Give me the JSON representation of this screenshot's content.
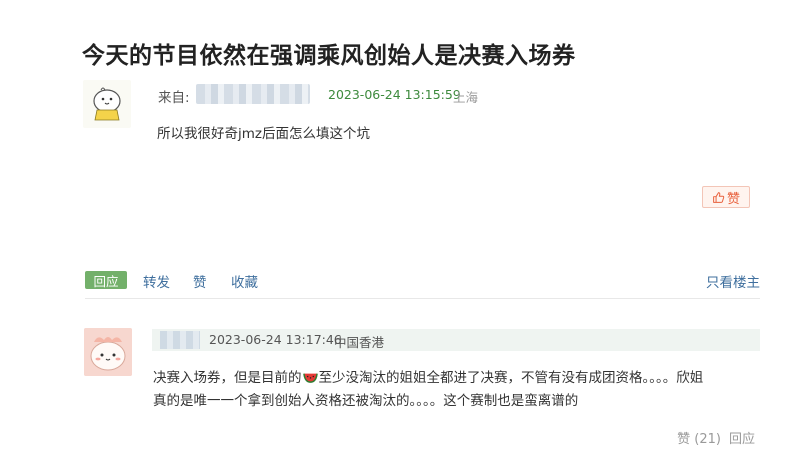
{
  "post": {
    "title": "今天的节目依然在强调乘风创始人是决赛入场券",
    "source_label": "来自:",
    "time": "2023-06-24 13:15:59",
    "location": "上海",
    "body": "所以我很好奇jmz后面怎么填这个坑",
    "like_label": "赞"
  },
  "actions": {
    "reply": "回应",
    "repost": "转发",
    "like": "赞",
    "collect": "收藏",
    "only_op": "只看楼主"
  },
  "reply": {
    "time": "2023-06-24 13:17:46",
    "location": "中国香港",
    "line1_a": "决赛入场券，但是目前的",
    "line1_b": "至少没淘汰的姐姐全都进了决赛，不管有没有成团资格。。。。欣姐",
    "line2": "真的是唯一一个拿到创始人资格还被淘汰的。。。。这个赛制也是蛮离谱的",
    "likes": "赞 (21)",
    "reply_label": "回应"
  },
  "colors": {
    "accent_green": "#73b06a",
    "link_blue": "#3f6f9e",
    "time_green": "#3d8a3d",
    "like_orange": "#e8603c"
  },
  "icons": [
    "chick-avatar-icon",
    "thumb-up-icon",
    "watermelon-emoji-icon",
    "pink-blob-avatar-icon"
  ]
}
